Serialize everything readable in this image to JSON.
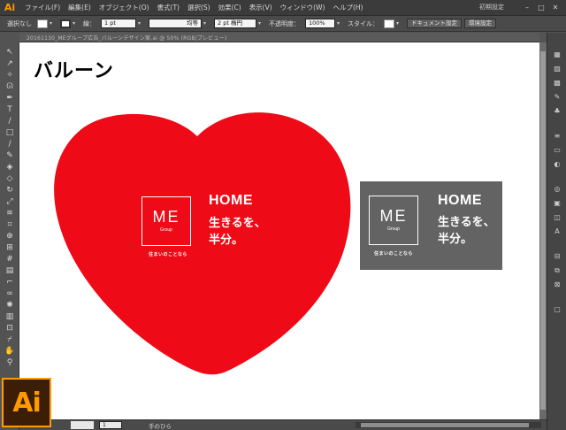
{
  "app": {
    "logo": "Ai",
    "brand_color": "#ff9a00",
    "menu": [
      "ファイル(F)",
      "編集(E)",
      "オブジェクト(O)",
      "書式(T)",
      "選択(S)",
      "効果(C)",
      "表示(V)",
      "ウィンドウ(W)",
      "ヘルプ(H)"
    ],
    "workspace": "初期設定",
    "window_buttons": [
      "–",
      "□",
      "✕"
    ]
  },
  "controlbar": {
    "selection_label": "選択なし",
    "stroke_label": "線：",
    "stroke_width": "1 pt",
    "line_style": "均等",
    "brush": "2 pt 楕円",
    "opacity_label": "不透明度：",
    "opacity_value": "100%",
    "style_label": "スタイル：",
    "doc_settings_button": "ドキュメント設定",
    "preferences_button": "環境設定"
  },
  "document": {
    "tab_title": "20161130_MEグループ広告_バルーンデザイン案.ai @ 50% (RGB/プレビュー)"
  },
  "canvas": {
    "heading": "バルーン",
    "heart_color": "#ee0a16",
    "gray_color": "#636363",
    "logo_me": "ME",
    "logo_group": "Group",
    "tagline": "住まいのことなら",
    "home": "HOME",
    "catch_line1": "生きるを、",
    "catch_line2": "半分。"
  },
  "statusbar": {
    "page": "1",
    "tool_name": "手のひら"
  },
  "toolbar": {
    "tools": [
      "selection-tool",
      "direct-selection-tool",
      "magic-wand-tool",
      "lasso-tool",
      "pen-tool",
      "type-tool",
      "line-tool",
      "rectangle-tool",
      "paintbrush-tool",
      "pencil-tool",
      "blob-brush-tool",
      "eraser-tool",
      "rotate-tool",
      "scale-tool",
      "width-tool",
      "free-transform-tool",
      "shape-builder-tool",
      "perspective-tool",
      "mesh-tool",
      "gradient-tool",
      "eyedropper-tool",
      "blend-tool",
      "symbol-sprayer-tool",
      "column-graph-tool",
      "artboard-tool",
      "slice-tool",
      "hand-tool",
      "zoom-tool"
    ]
  }
}
